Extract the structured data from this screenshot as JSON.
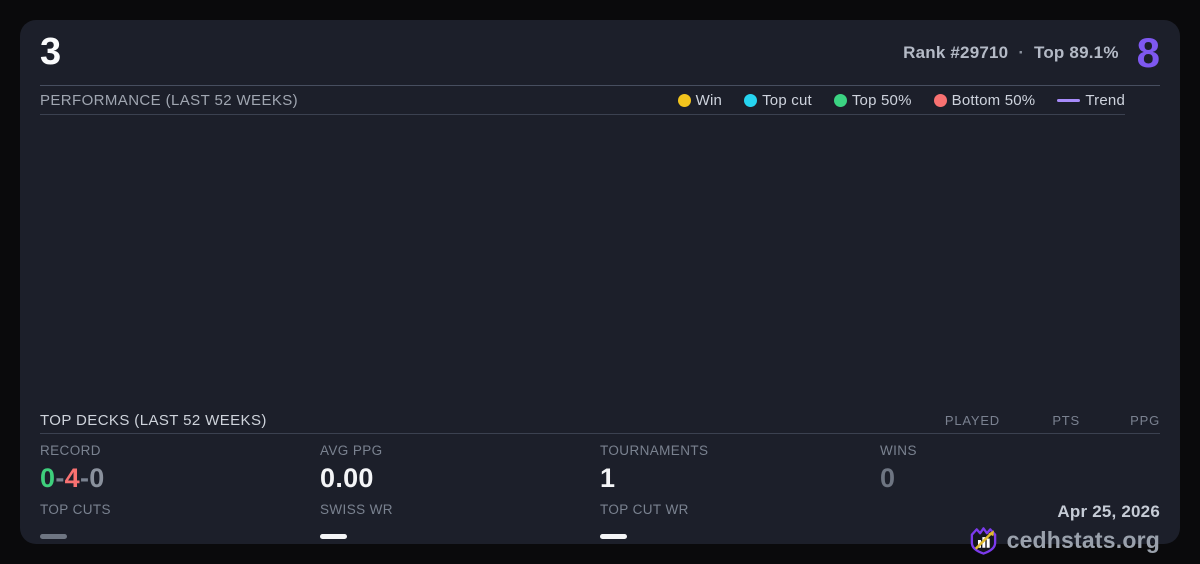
{
  "header": {
    "title": "3",
    "rank_label": "Rank #29710",
    "separator": "·",
    "top_percent_label": "Top 89.1%",
    "score": "8"
  },
  "performance": {
    "section_title": "PERFORMANCE (LAST 52 WEEKS)",
    "legend": [
      {
        "label": "Win",
        "color": "#f2c41d",
        "marker": "dot"
      },
      {
        "label": "Top cut",
        "color": "#26d4f0",
        "marker": "dot"
      },
      {
        "label": "Top 50%",
        "color": "#3bd382",
        "marker": "dot"
      },
      {
        "label": "Bottom 50%",
        "color": "#f87171",
        "marker": "dot"
      },
      {
        "label": "Trend",
        "color": "#a78bfa",
        "marker": "line"
      }
    ],
    "chart_points": []
  },
  "top_decks": {
    "section_title": "TOP DECKS (LAST 52 WEEKS)",
    "columns": [
      "PLAYED",
      "PTS",
      "PPG"
    ],
    "rows": []
  },
  "stats": {
    "record": {
      "label": "RECORD",
      "wins": "0",
      "losses": "4",
      "draws": "0",
      "separator": "-"
    },
    "avg_ppg": {
      "label": "AVG PPG",
      "value": "0.00"
    },
    "tournaments": {
      "label": "TOURNAMENTS",
      "value": "1"
    },
    "wins": {
      "label": "WINS",
      "value": "0"
    },
    "top_cuts": {
      "label": "TOP CUTS",
      "value": "—"
    },
    "swiss_wr": {
      "label": "SWISS WR",
      "value": "—"
    },
    "top_cut_wr": {
      "label": "TOP CUT WR",
      "value": "—"
    }
  },
  "footer": {
    "date": "Apr 25, 2026",
    "brand": "cedhstats.org"
  },
  "colors": {
    "accent_purple": "#7e58f0",
    "trend_purple": "#a78bfa",
    "record_win_green": "#3ecf7c",
    "record_loss_red": "#f87171",
    "record_draw_gray": "#8a919d",
    "muted_value_gray": "#6e7582",
    "value_white": "#f4f5f7",
    "card_background": "#1c1f2a"
  }
}
